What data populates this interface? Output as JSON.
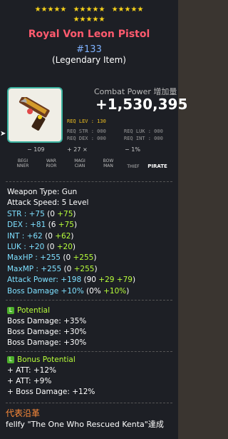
{
  "stars": {
    "row1": [
      "★★★★★",
      "★★★★★",
      "★★★★★"
    ],
    "row2": [
      "★★★★★"
    ]
  },
  "item": {
    "name": "Royal Von Leon Pistol",
    "number": "#133",
    "rank": "(Legendary Item)"
  },
  "combat": {
    "label": "Combat Power 增加量",
    "value": "+1,530,395"
  },
  "requirements": {
    "lev": "REQ LEV : 130",
    "str": "REQ STR : 000",
    "dex": "REQ DEX : 000",
    "luk": "REQ LUK : 000",
    "int": "REQ INT : 000"
  },
  "extra_row": {
    "a": "− 109",
    "b": "+ 27 ×",
    "c": "− 1%"
  },
  "classes": [
    "BEGI NNER",
    "WAR RIOR",
    "MAGI CIAN",
    "BOW MAN",
    "THIEF",
    "PIRATE"
  ],
  "stats": {
    "weapon_type": "Weapon Type: Gun",
    "attack_speed": "Attack Speed: 5 Level",
    "str": {
      "label": "STR : +75",
      "base": "(0 ",
      "bonus": "+75",
      ")": ")"
    },
    "dex": {
      "label": "DEX : +81",
      "base": "(6 ",
      "bonus": "+75"
    },
    "int": {
      "label": "INT : +62",
      "base": "(0 ",
      "bonus": "+62"
    },
    "luk": {
      "label": "LUK : +20",
      "base": "(0 ",
      "bonus": "+20"
    },
    "maxhp": {
      "label": "MaxHP : +255",
      "base": "(0 ",
      "bonus": "+255"
    },
    "maxmp": {
      "label": "MaxMP : +255",
      "base": "(0 ",
      "bonus": "+255"
    },
    "attack": {
      "label": "Attack Power: +198",
      "base": "(90 ",
      "bonus1": "+29",
      "bonus2": "+79"
    },
    "boss": {
      "label": "Boss Damage +10%",
      "base": "(0% ",
      "bonus": "+10%"
    }
  },
  "potential": {
    "header": "Potential",
    "lines": [
      "Boss Damage: +35%",
      "Boss Damage: +30%",
      "Boss Damage: +30%"
    ]
  },
  "bonus_potential": {
    "header": "Bonus Potential",
    "lines": [
      "+ ATT: +12%",
      "+ ATT: +9%",
      "+ Boss Damage: +12%"
    ]
  },
  "footer": {
    "header": "代表沿革",
    "text": "fellfy \"The One Who Rescued Kenta\"達成"
  },
  "colors": {
    "title": "#ff5a6e",
    "number": "#7fb2ff",
    "cyan": "#7ee0ff",
    "green": "#b8ff3a",
    "star": "#f6d21a"
  }
}
